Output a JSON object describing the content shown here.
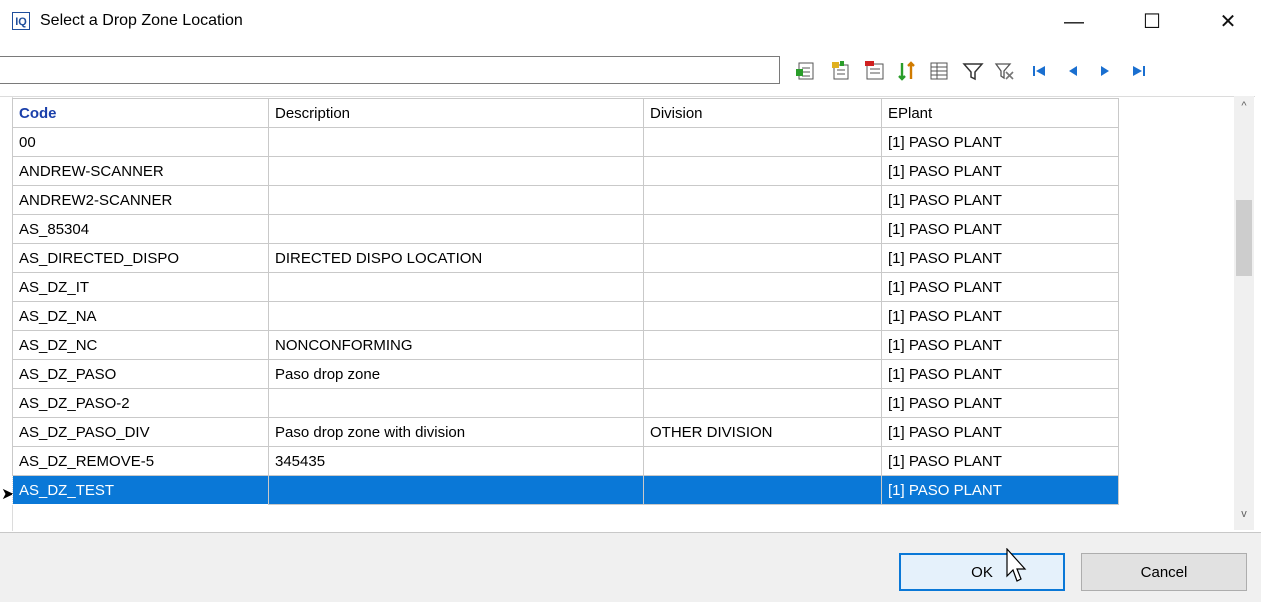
{
  "window": {
    "icon_text": "IQ",
    "title": "Select a Drop Zone Location",
    "minimize_glyph": "—",
    "maximize_glyph": "☐",
    "close_glyph": "✕"
  },
  "toolbar": {
    "search_value": "",
    "buttons": [
      "insert-record-icon",
      "edit-record-icon",
      "delete-record-icon",
      "sort-icon",
      "grid-view-icon",
      "filter-icon",
      "clear-filter-icon",
      "first-record-icon",
      "prior-record-icon",
      "next-record-icon",
      "last-record-icon"
    ]
  },
  "grid": {
    "columns": [
      "Code",
      "Description",
      "Division",
      "EPlant"
    ],
    "rows": [
      [
        "00",
        "",
        "",
        "[1]  PASO PLANT"
      ],
      [
        "ANDREW-SCANNER",
        "",
        "",
        "[1]  PASO PLANT"
      ],
      [
        "ANDREW2-SCANNER",
        "",
        "",
        "[1]  PASO PLANT"
      ],
      [
        "AS_85304",
        "",
        "",
        "[1]  PASO PLANT"
      ],
      [
        "AS_DIRECTED_DISPO",
        "DIRECTED DISPO LOCATION",
        "",
        "[1]  PASO PLANT"
      ],
      [
        "AS_DZ_IT",
        "",
        "",
        "[1]  PASO PLANT"
      ],
      [
        "AS_DZ_NA",
        "",
        "",
        "[1]  PASO PLANT"
      ],
      [
        "AS_DZ_NC",
        "NONCONFORMING",
        "",
        "[1]  PASO PLANT"
      ],
      [
        "AS_DZ_PASO",
        "Paso drop zone",
        "",
        "[1]  PASO PLANT"
      ],
      [
        "AS_DZ_PASO-2",
        "",
        "",
        "[1]  PASO PLANT"
      ],
      [
        "AS_DZ_PASO_DIV",
        "Paso drop zone with division",
        "OTHER DIVISION",
        "[1]  PASO PLANT"
      ],
      [
        "AS_DZ_REMOVE-5",
        "345435",
        "",
        "[1]  PASO PLANT"
      ],
      [
        "AS_DZ_TEST",
        "",
        "",
        "[1]  PASO PLANT"
      ]
    ],
    "selected_row": 12,
    "row_indicator": "➤"
  },
  "scrollbar": {
    "up_glyph": "^",
    "down_glyph": "v"
  },
  "buttons": {
    "ok": "OK",
    "cancel": "Cancel"
  },
  "colors": {
    "selection": "#0a78d7",
    "header_code": "#1a3faa",
    "ok_border": "#0a78d7"
  }
}
